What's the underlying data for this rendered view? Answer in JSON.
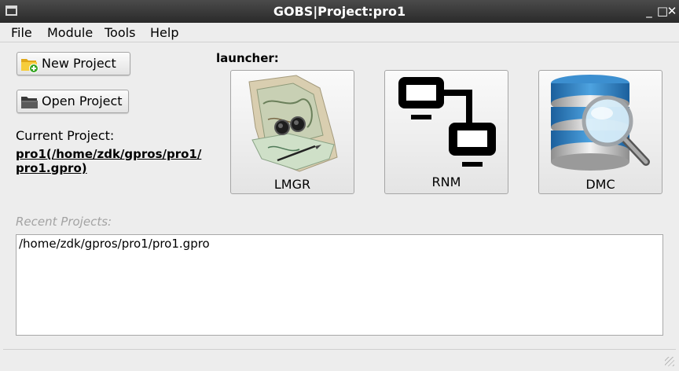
{
  "window": {
    "title": "GOBS|Project:pro1",
    "min_glyph": "_",
    "max_glyph": "□",
    "close_glyph": "✕"
  },
  "menu": {
    "items": [
      "File",
      "Module",
      "Tools",
      "Help"
    ]
  },
  "left_panel": {
    "new_project_label": "New Project",
    "open_project_label": "Open Project",
    "current_project_label": "Current Project:",
    "current_project_line1": "pro1(/home/zdk/gpros/pro1/",
    "current_project_line2": "pro1.gpro)"
  },
  "launcher": {
    "heading": "launcher:",
    "tiles": [
      {
        "label": "LMGR",
        "icon": "map-icon"
      },
      {
        "label": "RNM",
        "icon": "network-icon"
      },
      {
        "label": "DMC",
        "icon": "database-search-icon"
      }
    ]
  },
  "recent": {
    "label": "Recent Projects:",
    "items": [
      "/home/zdk/gpros/pro1/pro1.gpro"
    ]
  },
  "colors": {
    "titlebar": "#3a3a3a",
    "window_bg": "#ededed",
    "folder_yellow": "#f2c230",
    "add_green": "#37a524",
    "db_blue": "#2a7fc1"
  }
}
